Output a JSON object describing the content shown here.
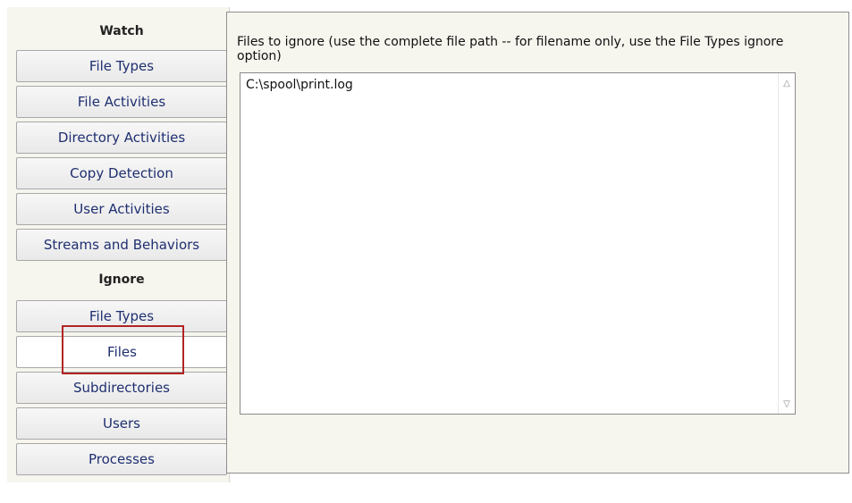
{
  "sidebar": {
    "watch_header": "Watch",
    "watch_items": [
      {
        "label": "File Types"
      },
      {
        "label": "File Activities"
      },
      {
        "label": "Directory Activities"
      },
      {
        "label": "Copy Detection"
      },
      {
        "label": "User Activities"
      },
      {
        "label": "Streams and Behaviors"
      }
    ],
    "ignore_header": "Ignore",
    "ignore_items": [
      {
        "label": "File Types"
      },
      {
        "label": "Files",
        "selected": true
      },
      {
        "label": "Subdirectories"
      },
      {
        "label": "Users"
      },
      {
        "label": "Processes"
      }
    ]
  },
  "panel": {
    "description": "Files to ignore (use the complete file path -- for filename only, use the File Types ignore option)",
    "files": [
      "C:\\spool\\print.log"
    ]
  },
  "icons": {
    "scroll_up": "chevron-up-icon",
    "scroll_down": "chevron-down-icon"
  },
  "colors": {
    "nav_text": "#1f2f70",
    "highlight": "#b22424",
    "panel_bg": "#f6f5ee"
  }
}
